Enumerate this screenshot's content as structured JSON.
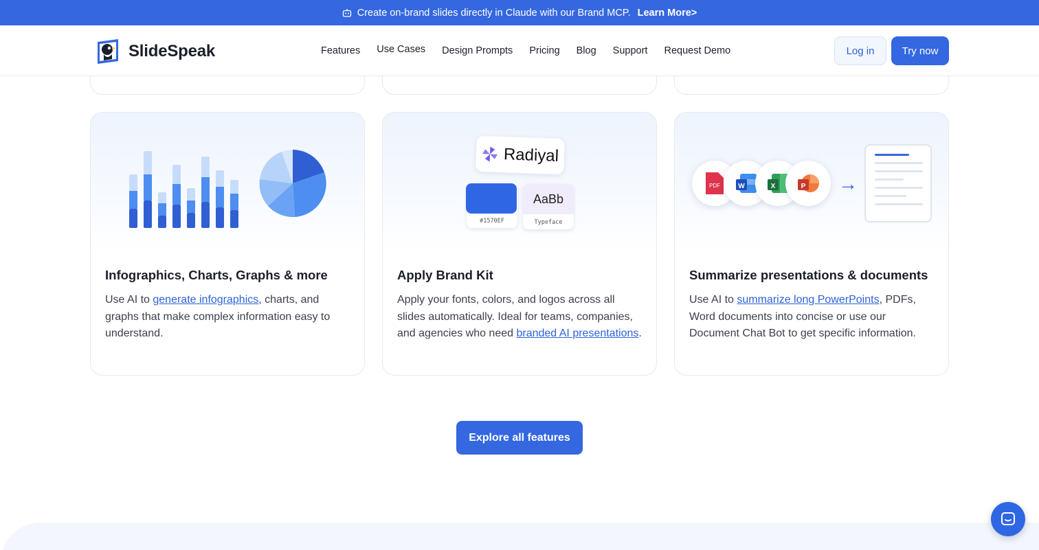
{
  "banner": {
    "text": "Create on-brand slides directly in Claude with our Brand MCP.",
    "link": "Learn More>"
  },
  "header": {
    "logo_text": "SlideSpeak",
    "nav": [
      "Features",
      "Use Cases",
      "Design Prompts",
      "Pricing",
      "Blog",
      "Support",
      "Request Demo"
    ],
    "login": "Log in",
    "try": "Try now"
  },
  "cards": [
    {
      "title": "Infographics, Charts, Graphs & more",
      "text_before": "Use AI to ",
      "link": "generate infographics",
      "text_after": ", charts, and graphs that make complex information easy to understand."
    },
    {
      "title": "Apply Brand Kit",
      "text_before": "Apply your fonts, colors, and logos across all slides automatically. Ideal for teams, companies, and agencies who need ",
      "link": "branded AI presentations",
      "text_after": ".",
      "brand_name": "Radiyal",
      "swatch_hex": "#1570EF",
      "typeface_sample": "AaBb",
      "typeface_label": "Typeface"
    },
    {
      "title": "Summarize presentations & documents",
      "text_before": "Use AI to ",
      "link": "summarize long PowerPoints",
      "text_after": ", PDFs, Word documents into concise or use our Document Chat Bot to get specific information.",
      "file_badges": [
        "PDF",
        "W",
        "X",
        "P"
      ]
    }
  ],
  "explore_button": "Explore all features",
  "colors": {
    "primary": "#3467e0",
    "link": "#2d62d8",
    "text": "#1b1f2a"
  }
}
